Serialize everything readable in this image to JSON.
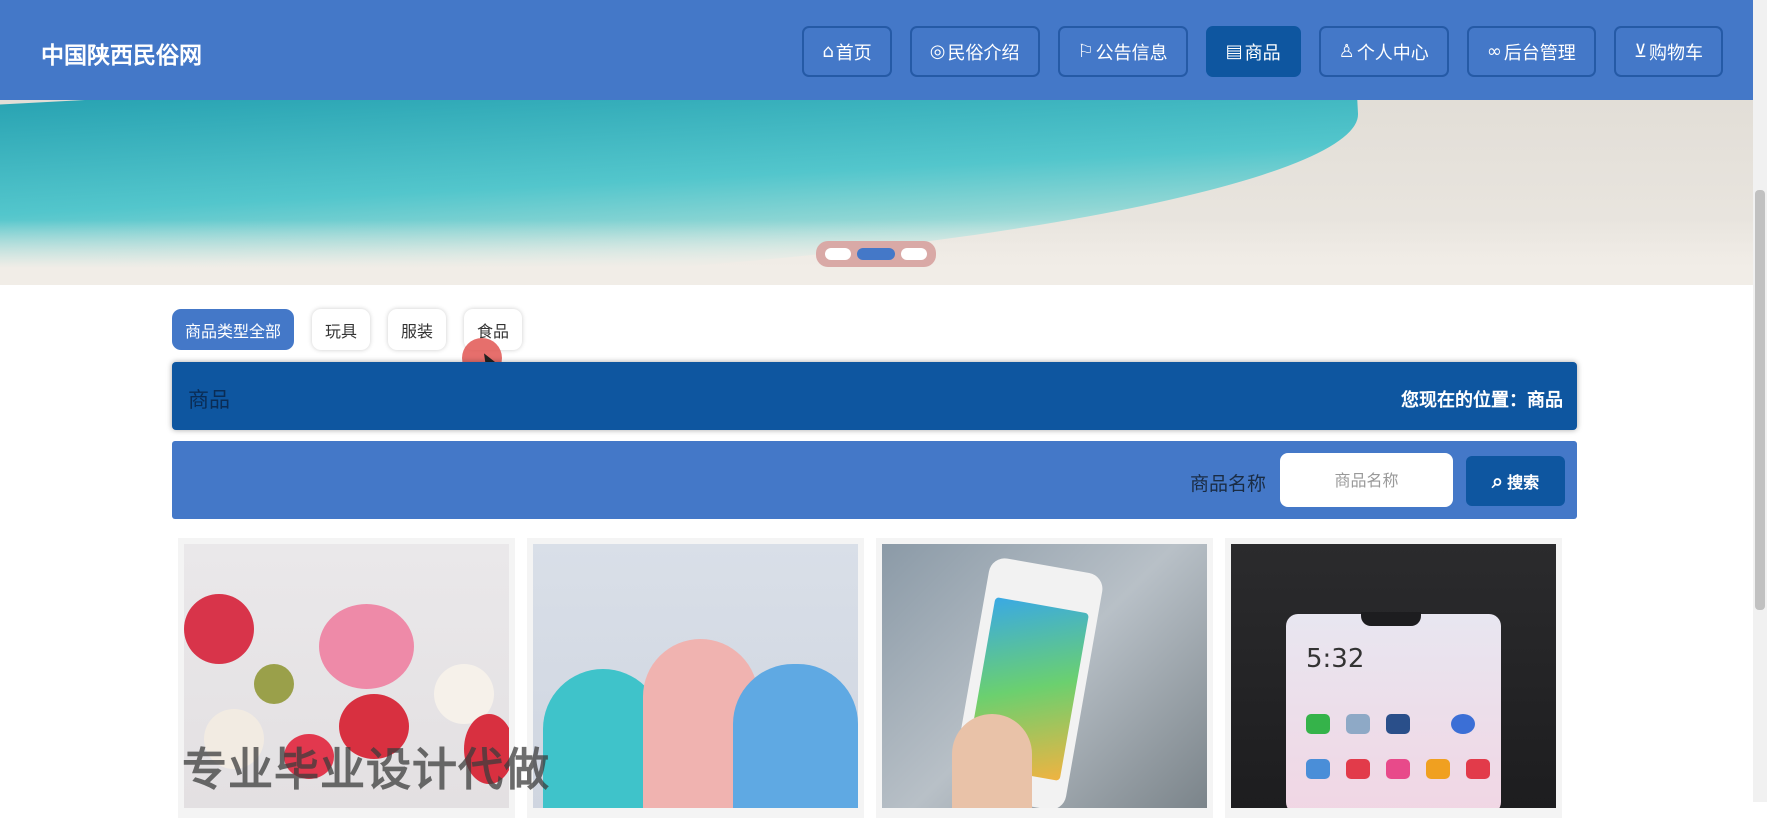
{
  "header": {
    "site_title": "中国陕西民俗网",
    "nav": [
      {
        "label": "首页",
        "icon": "home-icon",
        "glyph": "⌂"
      },
      {
        "label": "民俗介绍",
        "icon": "palette-icon",
        "glyph": "◎"
      },
      {
        "label": "公告信息",
        "icon": "flag-icon",
        "glyph": "⚐"
      },
      {
        "label": "商品",
        "icon": "calendar-icon",
        "glyph": "▤",
        "active": true
      },
      {
        "label": "个人中心",
        "icon": "user-icon",
        "glyph": "♙"
      },
      {
        "label": "后台管理",
        "icon": "link-icon",
        "glyph": "∞"
      },
      {
        "label": "购物车",
        "icon": "cart-icon",
        "glyph": "⊻"
      }
    ],
    "colors": {
      "bar": "#4478c8",
      "active": "#0e56a0"
    }
  },
  "banner": {
    "slides": 3,
    "active_slide": 2
  },
  "filters": {
    "chips": [
      {
        "label": "商品类型全部",
        "active": true
      },
      {
        "label": "玩具"
      },
      {
        "label": "服装"
      },
      {
        "label": "食品"
      }
    ]
  },
  "title_bar": {
    "title": "商品",
    "location": "您现在的位置：商品"
  },
  "search": {
    "label": "商品名称",
    "placeholder": "商品名称",
    "button_label": "搜索",
    "button_icon": "search-icon"
  },
  "products": [
    {
      "image": "flowers"
    },
    {
      "image": "cups"
    },
    {
      "image": "phone"
    },
    {
      "image": "phone-screen"
    }
  ],
  "watermark": "专业毕业设计代做"
}
